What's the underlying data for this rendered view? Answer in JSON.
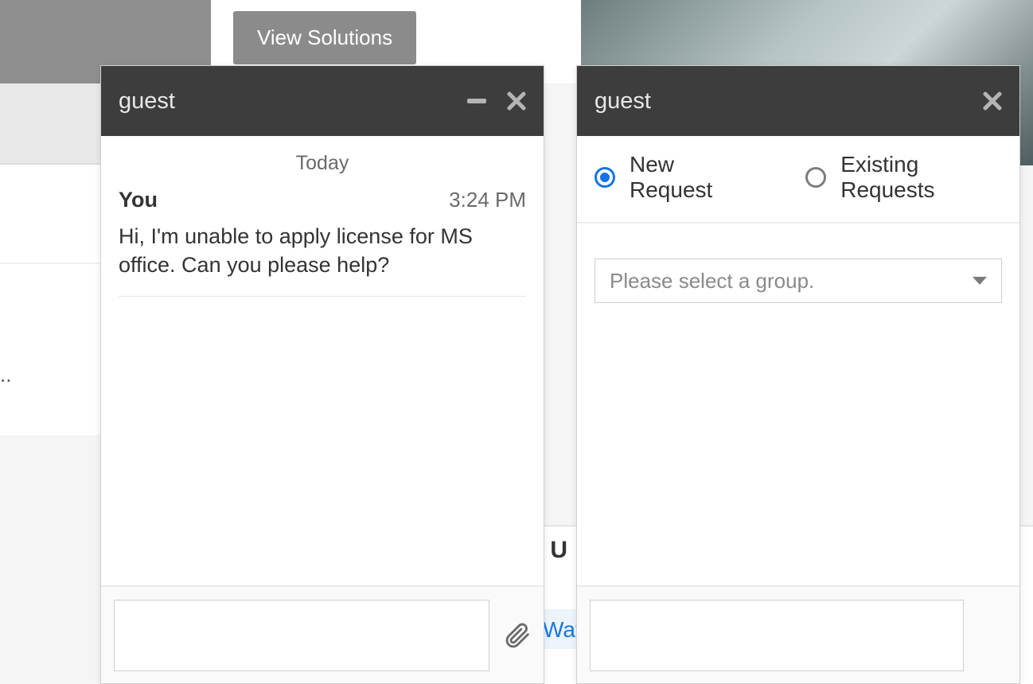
{
  "background": {
    "view_solutions_label": "View Solutions",
    "partial_text_1": "al U",
    "partial_text_2": "Wat",
    "partial_dots": ".."
  },
  "chat_left": {
    "header_title": "guest",
    "date_label": "Today",
    "message": {
      "sender": "You",
      "time": "3:24 PM",
      "text": "Hi, I'm unable to apply license for MS office. Can you please help?"
    },
    "input_value": ""
  },
  "chat_right": {
    "header_title": "guest",
    "radios": {
      "new_request": "New Request",
      "existing_requests": "Existing Requests"
    },
    "select_placeholder": "Please select a group.",
    "input_value": ""
  }
}
